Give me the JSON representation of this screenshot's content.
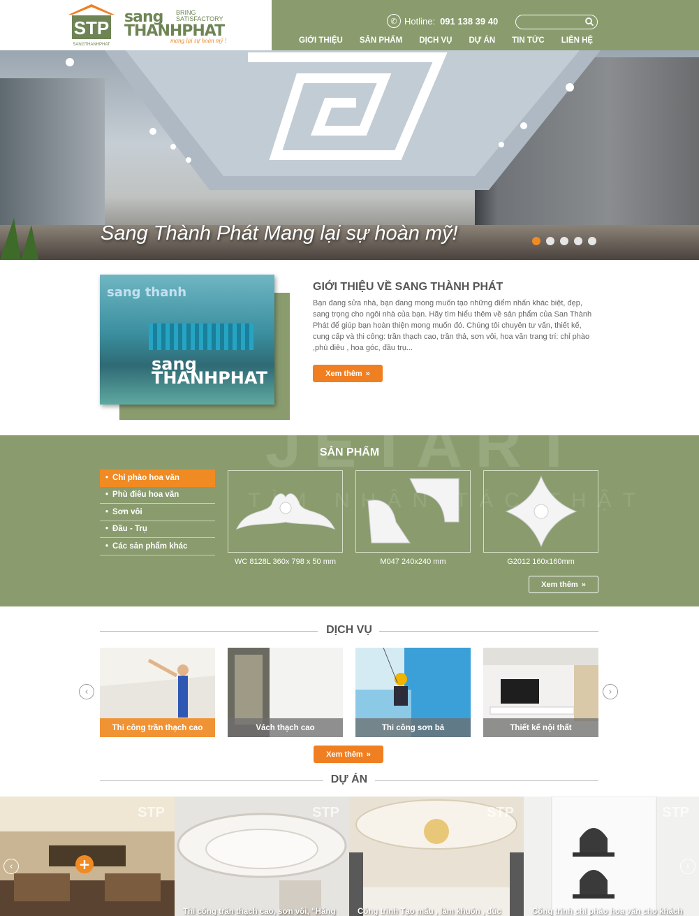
{
  "header": {
    "logo_word1": "sang",
    "logo_bring": "BRING",
    "logo_satisfactory": "SATISFACTORY",
    "logo_word2": "THANHPHAT",
    "logo_slogan": "mang lại sự hoàn mỹ !",
    "logo_small": "SANGTHANHPHAT",
    "hotline_label": "Hotline:",
    "hotline_number": "091 138 39 40",
    "search_placeholder": "",
    "nav": [
      "GIỚI THIỆU",
      "SẢN PHẨM",
      "DỊCH VỤ",
      "DỰ ÁN",
      "TIN TỨC",
      "LIÊN HỆ"
    ],
    "brand_color": "#8a9c6e",
    "accent_color": "#f08a22"
  },
  "hero": {
    "caption": "Sang Thành Phát Mang lại sự hoàn mỹ!",
    "slides_total": 5,
    "active_slide": 1
  },
  "about": {
    "title": "GIỚI THIỆU VỀ SANG THÀNH PHÁT",
    "text": "Bạn đang sửa nhà, bạn đang mong muốn tạo những điểm nhấn khác biệt, đẹp, sang trọng cho ngôi nhà của bạn. Hãy tìm hiểu thêm về sản phẩm của San Thành Phát để giúp bạn hoàn thiện mong muốn đó. Chúng tôi chuyên tư vấn, thiết kế, cung cấp và thi công: trần thạch cao, trần thả, sơn vôi, hoa văn trang trí: chỉ phào ,phù điêu , hoa góc, đầu trụ...",
    "button": "Xem thêm"
  },
  "watermark": {
    "brand": "JETART",
    "sub": "TÌM NHÂN TÁC THẬT"
  },
  "products": {
    "title": "SẢN PHẨM",
    "categories": [
      "Chỉ phào hoa văn",
      "Phù điêu hoa văn",
      "Sơn vôi",
      "Đầu - Trụ",
      "Các sản phẩm khác"
    ],
    "active_category": 0,
    "items": [
      {
        "label": "WC 8128L 360x 798 x 50 mm"
      },
      {
        "label": "M047 240x240 mm"
      },
      {
        "label": "G2012 160x160mm"
      }
    ],
    "button": "Xem thêm"
  },
  "services": {
    "title": "DỊCH VỤ",
    "items": [
      {
        "label": "Thi công trần thạch cao"
      },
      {
        "label": "Vách thạch cao"
      },
      {
        "label": "Thi công sơn bả"
      },
      {
        "label": "Thiết kế nội thất"
      }
    ],
    "button": "Xem thêm"
  },
  "projects": {
    "title": "DỰ ÁN",
    "items": [
      {
        "caption": ""
      },
      {
        "caption": "Thi công trần thạch cao, sơn vôi, “Hăng"
      },
      {
        "caption": "Công trình Tạo mẫu , làm khuôn , đúc"
      },
      {
        "caption": "Công trình chỉ phào hoa văn cho khách"
      }
    ]
  }
}
